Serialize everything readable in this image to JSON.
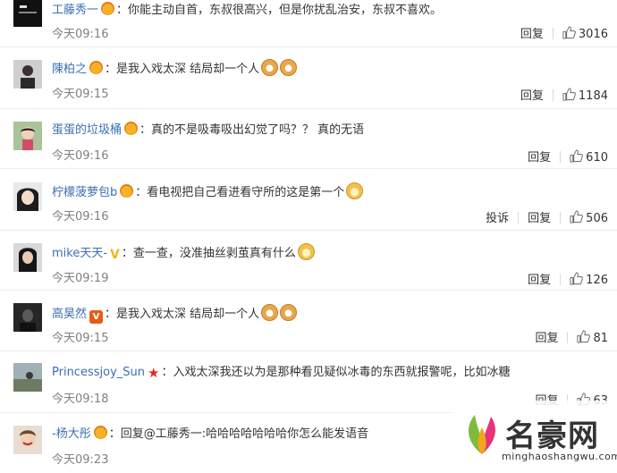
{
  "comments": [
    {
      "user": "工藤秀一",
      "badge": "crown",
      "sep": "：",
      "text": "你能主动自首，东叔很高兴，但是你扰乱治安，东叔不喜欢。",
      "emoji": [],
      "time": "今天09:16",
      "report": "",
      "reply": "回复",
      "likes": "3016",
      "avatar": "avatar-dark-text"
    },
    {
      "user": "陳柏之",
      "badge": "crown",
      "sep": "：",
      "text": "是我入戏太深 结局却一个人",
      "emoji": [
        "cat-icon",
        "cat-icon"
      ],
      "time": "今天09:15",
      "report": "",
      "reply": "回复",
      "likes": "1184",
      "avatar": "avatar-person"
    },
    {
      "user": "蛋蛋的垃圾桶",
      "badge": "crown",
      "sep": "：",
      "text": "真的不是吸毒吸出幻觉了吗？？ 真的无语",
      "emoji": [],
      "time": "今天09:16",
      "report": "",
      "reply": "回复",
      "likes": "610",
      "avatar": "avatar-girl"
    },
    {
      "user": "柠檬菠萝包b",
      "badge": "crown",
      "sep": "：",
      "text": "看电视把自己看进看守所的这是第一个",
      "emoji": [
        "doge-icon"
      ],
      "time": "今天09:16",
      "report": "投诉",
      "reply": "回复",
      "likes": "506",
      "avatar": "avatar-face"
    },
    {
      "user": "mike天天-",
      "badge": "vyellow",
      "sep": "：",
      "text": "查一查，没准抽丝剥茧真有什么",
      "emoji": [
        "doge-icon"
      ],
      "time": "今天09:19",
      "report": "",
      "reply": "回复",
      "likes": "126",
      "avatar": "avatar-portrait"
    },
    {
      "user": "高昊然",
      "badge": "vip",
      "sep": "：",
      "text": "是我入戏太深 结局却一个人",
      "emoji": [
        "cat-icon",
        "cat-icon"
      ],
      "time": "今天09:15",
      "report": "",
      "reply": "回复",
      "likes": "81",
      "avatar": "avatar-dark"
    },
    {
      "user": "Princessjoy_Sun",
      "badge": "star",
      "sep": "：",
      "text": "入戏太深我还以为是那种看见疑似冰毒的东西就报警呢，比如冰糖",
      "emoji": [],
      "time": "今天09:18",
      "report": "",
      "reply": "回复",
      "likes": "63",
      "avatar": "avatar-outdoor"
    },
    {
      "user": "-杨大彤",
      "badge": "crown",
      "sep": "：",
      "text": "回复@工藤秀一:哈哈哈哈哈哈哈你怎么能发语音",
      "emoji": [],
      "time": "今天09:23",
      "report": "",
      "reply": "",
      "likes": "",
      "avatar": "avatar-smile"
    }
  ],
  "vip_badge_text": "V",
  "vyellow_text": "V",
  "star_text": "★",
  "watermark": {
    "title": "名豪网",
    "url": "minghaoshangwu.com"
  }
}
